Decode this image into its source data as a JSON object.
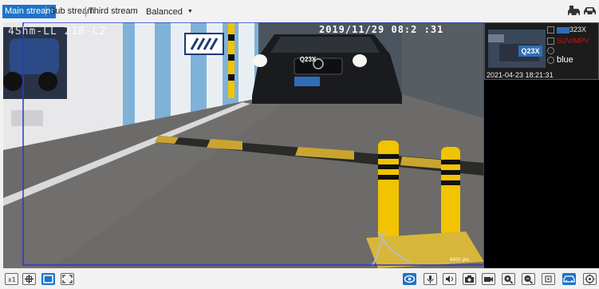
{
  "toolbar": {
    "tabs": [
      {
        "label": "Main stream",
        "active": true
      },
      {
        "label": "Sub stream",
        "active": false
      },
      {
        "label": "Third stream",
        "active": false
      }
    ],
    "quality_label": "Balanced",
    "icons": [
      "vehicle-snapshot-icon",
      "vehicle-recognition-icon"
    ]
  },
  "video": {
    "timestamp_left": "4Shm-LL 21B-L2",
    "timestamp_right": "2019/11/29 08:2 :31",
    "plate_overlay": "Q23X",
    "corner_label": "640X pro"
  },
  "capture": {
    "plate_text": "323X",
    "thumb_plate": "Q23X",
    "vehicle_type": "SUV/MPV",
    "color": "blue",
    "time": "2021-04-23 18:21:31"
  },
  "bottom_toolbar": {
    "left_icons": [
      "original-size-icon",
      "fit-window-icon",
      "stretch-icon",
      "fullscreen-icon"
    ],
    "right_icons": [
      "preview-icon",
      "microphone-icon",
      "audio-icon",
      "snapshot-icon",
      "record-icon",
      "zoom-in-icon",
      "zoom-out-icon",
      "3d-position-icon",
      "vehicle-panel-icon",
      "ptz-icon"
    ]
  },
  "colors": {
    "accent": "#1e73c8",
    "plate_bg": "#2f6db8",
    "bollard_yellow": "#f2c300",
    "vehicle_type_red": "#c21a1a"
  }
}
